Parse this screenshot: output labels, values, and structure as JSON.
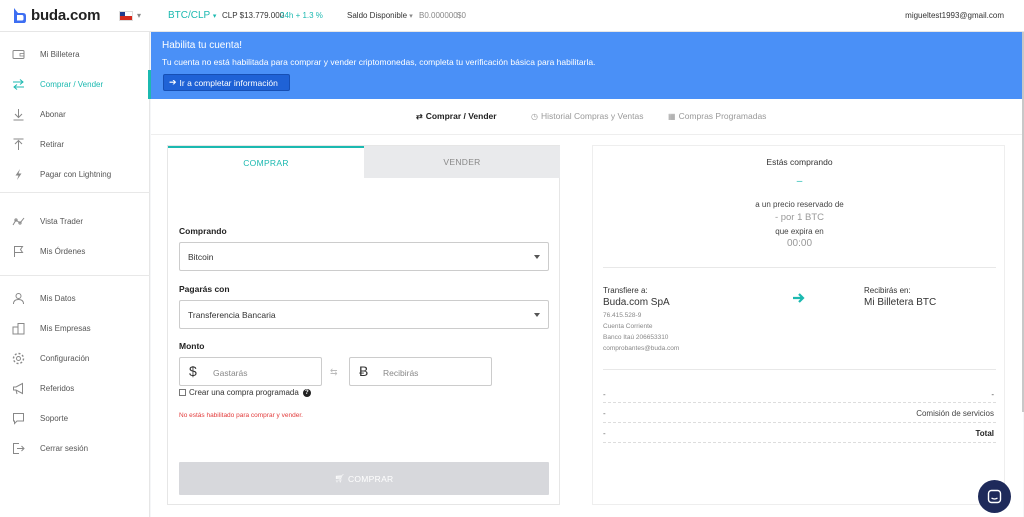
{
  "topbar": {
    "logo_text": "buda.com",
    "pair": "BTC/CLP",
    "pair_chevron": "▾",
    "price": "CLP $13.779.000",
    "change": "24h + 1.3 %",
    "saldo_label": "Saldo Disponible",
    "saldo_chevron": "▾",
    "balance_btc": "B0.000000",
    "balance_clp": "$0",
    "email": "migueltest1993@gmail.com"
  },
  "sidebar": {
    "items": [
      {
        "label": "Mi Billetera",
        "icon": "wallet-icon"
      },
      {
        "label": "Comprar / Vender",
        "icon": "exchange-icon"
      },
      {
        "label": "Abonar",
        "icon": "download-arrow-icon"
      },
      {
        "label": "Retirar",
        "icon": "upload-arrow-icon"
      },
      {
        "label": "Pagar con Lightning",
        "icon": "lightning-icon"
      },
      {
        "label": "Vista Trader",
        "icon": "chart-line-icon"
      },
      {
        "label": "Mis Órdenes",
        "icon": "flag-icon"
      },
      {
        "label": "Mis Datos",
        "icon": "user-icon"
      },
      {
        "label": "Mis Empresas",
        "icon": "building-icon"
      },
      {
        "label": "Configuración",
        "icon": "gear-icon"
      },
      {
        "label": "Referidos",
        "icon": "megaphone-icon"
      },
      {
        "label": "Soporte",
        "icon": "chat-icon"
      },
      {
        "label": "Cerrar sesión",
        "icon": "logout-icon"
      }
    ]
  },
  "banner": {
    "title": "Habilita tu cuenta!",
    "text": "Tu cuenta no está habilitada para comprar y vender criptomonedas, completa tu verificación básica para habilitarla.",
    "button_label": "Ir a completar información",
    "bg_color": "#4a90f7"
  },
  "content_tabs": {
    "buy_sell": "Comprar / Vender",
    "history": "Historial Compras y Ventas",
    "scheduled": "Compras Programadas"
  },
  "order_form": {
    "tab_buy": "COMPRAR",
    "tab_sell": "VENDER",
    "buying_label": "Comprando",
    "buying_value": "Bitcoin",
    "pay_label": "Pagarás con",
    "pay_value": "Transferencia Bancaria",
    "amount_label": "Monto",
    "spend_symbol": "$",
    "spend_placeholder": "Gastarás",
    "receive_symbol": "Ƀ",
    "receive_placeholder": "Recibirás",
    "scheduled_checkbox": "Crear una compra programada",
    "error": "No estás habilitado para comprar y vender.",
    "submit_label": "COMPRAR",
    "accent_color": "#1bb9b0",
    "error_color": "#e23b3b"
  },
  "summary": {
    "title": "Estás comprando",
    "amount": "–",
    "reserved_price_text": "a un precio reservado de",
    "price_per_btc": "- por 1 BTC",
    "expires_text": "que expira en",
    "timer": "00:00",
    "transfer_label": "Transfiere a:",
    "transfer_name": "Buda.com SpA",
    "transfer_rut": "76.415.528-9",
    "transfer_account": "Cuenta Corriente",
    "transfer_bank": "Banco Itaú 206653310",
    "transfer_email": "comprobantes@buda.com",
    "receive_label": "Recibirás en:",
    "receive_name": "Mi Billetera BTC",
    "rows": [
      {
        "left": "-",
        "right": "-"
      },
      {
        "left": "-",
        "right": "Comisión de servicios"
      },
      {
        "left": "-",
        "right": "Total"
      }
    ]
  }
}
